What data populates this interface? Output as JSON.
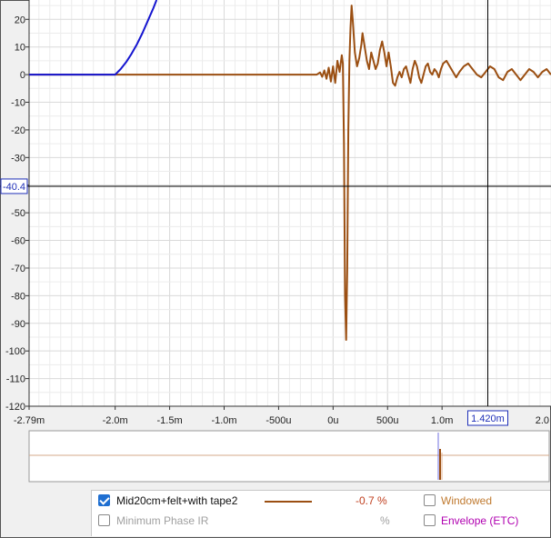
{
  "colors": {
    "ir": "#9b4f12",
    "step": "#1515d0",
    "overview_line": "#d6a98a",
    "cursor_box": "#1f2fb8",
    "grid": "#dadada",
    "windowed": "#c07a30",
    "envelope": "#b000b0",
    "disabled": "#a0a0a0"
  },
  "chart_data": {
    "type": "line",
    "xlim": [
      -2.79,
      2.0
    ],
    "ylim": [
      -120,
      27
    ],
    "x_unit": "ms",
    "x_ticks": [
      {
        "value": -2.79,
        "label": "-2.79m"
      },
      {
        "value": -2.0,
        "label": "-2.0m"
      },
      {
        "value": -1.5,
        "label": "-1.5m"
      },
      {
        "value": -1.0,
        "label": "-1.0m"
      },
      {
        "value": -0.5,
        "label": "-500u"
      },
      {
        "value": 0.0,
        "label": "0u"
      },
      {
        "value": 0.5,
        "label": "500u"
      },
      {
        "value": 1.0,
        "label": "1.0m"
      },
      {
        "value": 1.42,
        "label": "1.420m"
      },
      {
        "value": 2.0,
        "label": "2.0"
      }
    ],
    "y_ticks": [
      20,
      10,
      0,
      -10,
      -20,
      -30,
      -40,
      -50,
      -60,
      -70,
      -80,
      -90,
      -100,
      -110,
      -120
    ],
    "cursor": {
      "x": 1.42,
      "x_label": "1.420m",
      "y": -40.4,
      "y_label": "-40.4"
    },
    "series": [
      {
        "name": "Mid20cm+felt+with tape2",
        "color": "#9b4f12",
        "points": [
          [
            -2.79,
            0
          ],
          [
            -2.0,
            0
          ],
          [
            -0.3,
            0
          ],
          [
            -0.15,
            0
          ],
          [
            -0.12,
            0.8
          ],
          [
            -0.1,
            -0.8
          ],
          [
            -0.08,
            1.5
          ],
          [
            -0.06,
            -1.5
          ],
          [
            -0.04,
            2.5
          ],
          [
            -0.02,
            -2.5
          ],
          [
            0.0,
            3
          ],
          [
            0.02,
            -3
          ],
          [
            0.04,
            5
          ],
          [
            0.06,
            1
          ],
          [
            0.08,
            7
          ],
          [
            0.09,
            4
          ],
          [
            0.1,
            -25
          ],
          [
            0.11,
            -80
          ],
          [
            0.12,
            -96
          ],
          [
            0.13,
            -70
          ],
          [
            0.14,
            -20
          ],
          [
            0.15,
            5
          ],
          [
            0.16,
            17
          ],
          [
            0.17,
            25
          ],
          [
            0.18,
            20
          ],
          [
            0.2,
            8
          ],
          [
            0.22,
            3
          ],
          [
            0.24,
            6
          ],
          [
            0.26,
            11
          ],
          [
            0.27,
            15
          ],
          [
            0.29,
            10
          ],
          [
            0.31,
            5
          ],
          [
            0.33,
            2
          ],
          [
            0.35,
            8
          ],
          [
            0.37,
            5
          ],
          [
            0.39,
            2
          ],
          [
            0.41,
            4
          ],
          [
            0.43,
            9
          ],
          [
            0.45,
            12
          ],
          [
            0.47,
            8
          ],
          [
            0.49,
            3
          ],
          [
            0.51,
            8
          ],
          [
            0.53,
            3
          ],
          [
            0.55,
            -3
          ],
          [
            0.57,
            -4
          ],
          [
            0.59,
            -1
          ],
          [
            0.61,
            1
          ],
          [
            0.63,
            -1
          ],
          [
            0.65,
            2
          ],
          [
            0.67,
            3
          ],
          [
            0.69,
            0
          ],
          [
            0.71,
            -3
          ],
          [
            0.73,
            2
          ],
          [
            0.75,
            5
          ],
          [
            0.77,
            3
          ],
          [
            0.79,
            -1
          ],
          [
            0.81,
            -3
          ],
          [
            0.83,
            0
          ],
          [
            0.85,
            3
          ],
          [
            0.87,
            4
          ],
          [
            0.89,
            1
          ],
          [
            0.91,
            0
          ],
          [
            0.93,
            2
          ],
          [
            0.95,
            1
          ],
          [
            0.97,
            -1
          ],
          [
            0.99,
            2
          ],
          [
            1.01,
            4
          ],
          [
            1.04,
            5
          ],
          [
            1.07,
            3
          ],
          [
            1.1,
            1
          ],
          [
            1.13,
            -1
          ],
          [
            1.16,
            1
          ],
          [
            1.2,
            3
          ],
          [
            1.24,
            4
          ],
          [
            1.28,
            2
          ],
          [
            1.32,
            0
          ],
          [
            1.36,
            -1
          ],
          [
            1.4,
            1
          ],
          [
            1.44,
            3
          ],
          [
            1.48,
            2
          ],
          [
            1.52,
            -1
          ],
          [
            1.56,
            -2
          ],
          [
            1.6,
            1
          ],
          [
            1.64,
            2
          ],
          [
            1.68,
            0
          ],
          [
            1.72,
            -2
          ],
          [
            1.76,
            0
          ],
          [
            1.8,
            2
          ],
          [
            1.84,
            1
          ],
          [
            1.88,
            -1
          ],
          [
            1.92,
            1
          ],
          [
            1.96,
            2
          ],
          [
            2.0,
            0
          ]
        ]
      },
      {
        "color": "#1515d0",
        "points": [
          [
            -2.79,
            0
          ],
          [
            -2.0,
            0
          ],
          [
            -1.95,
            2
          ],
          [
            -1.9,
            4.5
          ],
          [
            -1.85,
            7.5
          ],
          [
            -1.8,
            11
          ],
          [
            -1.75,
            15
          ],
          [
            -1.7,
            19.5
          ],
          [
            -1.65,
            24
          ],
          [
            -1.62,
            27
          ]
        ]
      }
    ]
  },
  "overview": {
    "signal_start": 0.08,
    "signal_end": 0.14
  },
  "legend": {
    "row1": {
      "checked": true,
      "name": "Mid20cm+felt+with tape2",
      "value": "-0.7 %",
      "option": "Windowed"
    },
    "row2": {
      "checked": false,
      "name": "Minimum Phase IR",
      "value": "%",
      "option": "Envelope (ETC)"
    }
  }
}
